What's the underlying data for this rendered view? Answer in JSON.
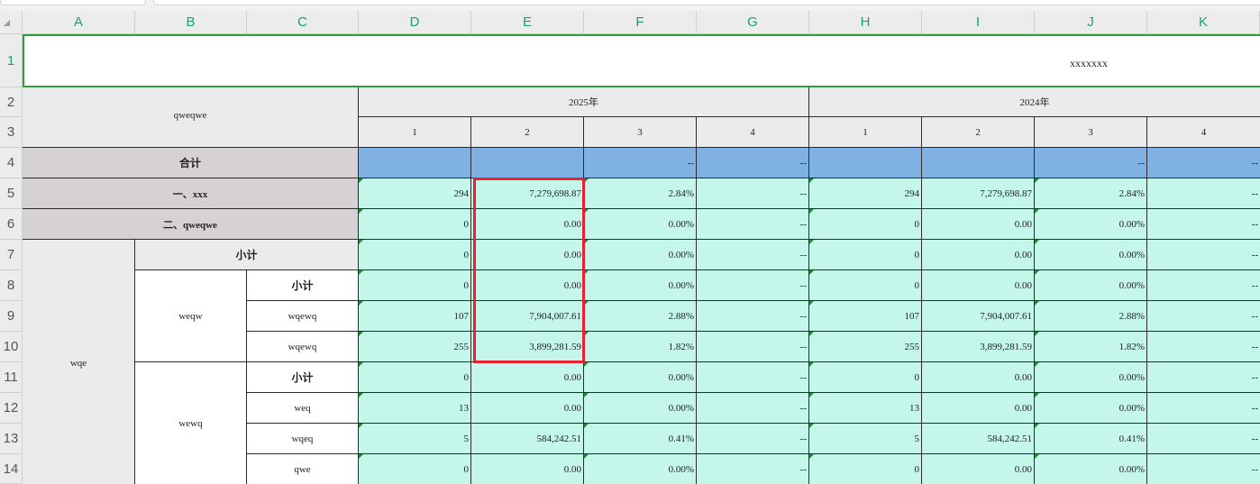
{
  "columns": [
    "A",
    "B",
    "C",
    "D",
    "E",
    "F",
    "G",
    "H",
    "I",
    "J",
    "K"
  ],
  "rows": [
    "1",
    "2",
    "3",
    "4",
    "5",
    "6",
    "7",
    "8",
    "9",
    "10",
    "11",
    "12",
    "13",
    "14"
  ],
  "title_value": "xxxxxxx",
  "header": {
    "corner_label": "qweqwe",
    "year_2025": "2025年",
    "year_2024": "2024年",
    "sub_cols": [
      "1",
      "2",
      "3",
      "4",
      "1",
      "2",
      "3",
      "4"
    ]
  },
  "labels": {
    "total": "合计",
    "item1": "一、xxx",
    "item2": "二、qweqwe",
    "wqe": "wqe",
    "subtotal": "小计",
    "weqw": "weqw",
    "wewq": "wewq",
    "r9": "wqewq",
    "r10": "wqewq",
    "r12": "weq",
    "r13": "wqeq",
    "r14": "qwe"
  },
  "data_rows": [
    {
      "row": "4",
      "vals": [
        "",
        "",
        "--",
        "--",
        "",
        "",
        "--",
        "--"
      ]
    },
    {
      "row": "5",
      "vals": [
        "294",
        "7,279,698.87",
        "2.84%",
        "--",
        "294",
        "7,279,698.87",
        "2.84%",
        "--"
      ]
    },
    {
      "row": "6",
      "vals": [
        "0",
        "0.00",
        "0.00%",
        "--",
        "0",
        "0.00",
        "0.00%",
        "--"
      ]
    },
    {
      "row": "7",
      "vals": [
        "0",
        "0.00",
        "0.00%",
        "--",
        "0",
        "0.00",
        "0.00%",
        "--"
      ]
    },
    {
      "row": "8",
      "vals": [
        "0",
        "0.00",
        "0.00%",
        "--",
        "0",
        "0.00",
        "0.00%",
        "--"
      ]
    },
    {
      "row": "9",
      "vals": [
        "107",
        "7,904,007.61",
        "2.88%",
        "--",
        "107",
        "7,904,007.61",
        "2.88%",
        "--"
      ]
    },
    {
      "row": "10",
      "vals": [
        "255",
        "3,899,281.59",
        "1.82%",
        "--",
        "255",
        "3,899,281.59",
        "1.82%",
        "--"
      ]
    },
    {
      "row": "11",
      "vals": [
        "0",
        "0.00",
        "0.00%",
        "--",
        "0",
        "0.00",
        "0.00%",
        "--"
      ]
    },
    {
      "row": "12",
      "vals": [
        "13",
        "0.00",
        "0.00%",
        "--",
        "13",
        "0.00",
        "0.00%",
        "--"
      ]
    },
    {
      "row": "13",
      "vals": [
        "5",
        "584,242.51",
        "0.41%",
        "--",
        "5",
        "584,242.51",
        "0.41%",
        "--"
      ]
    },
    {
      "row": "14",
      "vals": [
        "0",
        "0.00",
        "0.00%",
        "--",
        "0",
        "0.00",
        "0.00%",
        "--"
      ]
    }
  ],
  "colors": {
    "header_gray": "#ebebeb",
    "label_mauve": "#d6d2d3",
    "total_blue": "#7fb1e3",
    "data_mint": "#c4f7ea",
    "selection_green": "#2e9e3e",
    "highlight_red": "#e8202f"
  },
  "icons": {
    "select_all": "select-all-triangle-icon",
    "cell_flag": "green-corner-triangle-icon"
  }
}
